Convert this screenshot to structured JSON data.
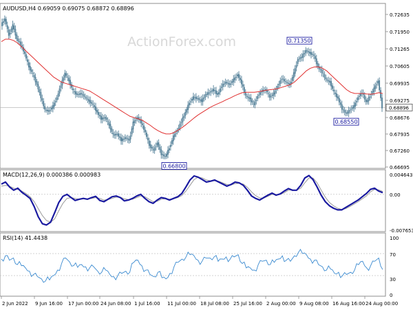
{
  "chart_data": [
    {
      "type": "candlestick",
      "panel": "price",
      "title": "AUDUSD,H4  0.69059 0.69075 0.68872 0.68896",
      "watermark": "ActionForex.com",
      "y_ticks": [
        "0.72635",
        "0.71950",
        "0.71265",
        "0.70605",
        "0.69935",
        "0.69275",
        "0.68676",
        "0.67935",
        "0.67260",
        "0.66695"
      ],
      "ylim": [
        0.6665,
        0.7285
      ],
      "current_price": "0.68896",
      "current_price_value": 0.68896,
      "annotations": [
        {
          "label": "0.71350",
          "value": 0.7135
        },
        {
          "label": "0.66800",
          "value": 0.668
        },
        {
          "label": "0.68550",
          "value": 0.6855
        }
      ],
      "series": [
        {
          "name": "price",
          "color": "#4f7d96",
          "points": [
            0.7215,
            0.724,
            0.7175,
            0.7215,
            0.716,
            0.714,
            0.71,
            0.705,
            0.702,
            0.698,
            0.693,
            0.688,
            0.6875,
            0.6895,
            0.693,
            0.698,
            0.7025,
            0.6995,
            0.6955,
            0.694,
            0.6945,
            0.693,
            0.6915,
            0.69,
            0.687,
            0.6845,
            0.685,
            0.682,
            0.678,
            0.6785,
            0.676,
            0.677,
            0.676,
            0.683,
            0.685,
            0.683,
            0.679,
            0.674,
            0.672,
            0.675,
            0.6705,
            0.6695,
            0.673,
            0.6775,
            0.68,
            0.6835,
            0.687,
            0.691,
            0.693,
            0.6925,
            0.6915,
            0.694,
            0.695,
            0.696,
            0.694,
            0.6975,
            0.699,
            0.698,
            0.7,
            0.702,
            0.6985,
            0.6935,
            0.6925,
            0.69,
            0.6935,
            0.6955,
            0.696,
            0.693,
            0.6945,
            0.6975,
            0.7005,
            0.699,
            0.698,
            0.7025,
            0.708,
            0.709,
            0.7115,
            0.7105,
            0.7095,
            0.705,
            0.703,
            0.7,
            0.699,
            0.695,
            0.6925,
            0.6885,
            0.6865,
            0.688,
            0.6895,
            0.693,
            0.695,
            0.691,
            0.6935,
            0.6965,
            0.6995,
            0.689
          ]
        },
        {
          "name": "moving-average",
          "color": "#e03030",
          "points": [
            0.715,
            0.716,
            0.716,
            0.7155,
            0.7145,
            0.713,
            0.7115,
            0.71,
            0.7085,
            0.707,
            0.7055,
            0.704,
            0.7025,
            0.701,
            0.7,
            0.699,
            0.6985,
            0.698,
            0.6975,
            0.697,
            0.6965,
            0.696,
            0.6955,
            0.6945,
            0.6935,
            0.6925,
            0.6915,
            0.6905,
            0.6895,
            0.6885,
            0.6875,
            0.6865,
            0.6855,
            0.685,
            0.6845,
            0.684,
            0.683,
            0.682,
            0.6808,
            0.6798,
            0.679,
            0.6785,
            0.6785,
            0.679,
            0.68,
            0.681,
            0.6822,
            0.6835,
            0.6848,
            0.686,
            0.687,
            0.688,
            0.689,
            0.6898,
            0.6905,
            0.6912,
            0.692,
            0.6927,
            0.6935,
            0.6942,
            0.6948,
            0.695,
            0.695,
            0.695,
            0.6952,
            0.6955,
            0.6958,
            0.696,
            0.6962,
            0.6965,
            0.697,
            0.6975,
            0.698,
            0.699,
            0.7005,
            0.702,
            0.7035,
            0.7045,
            0.705,
            0.705,
            0.7045,
            0.7035,
            0.702,
            0.7005,
            0.699,
            0.6975,
            0.696,
            0.695,
            0.6945,
            0.6945,
            0.6945,
            0.6943,
            0.6942,
            0.6944,
            0.6948,
            0.6945
          ]
        }
      ]
    },
    {
      "type": "line",
      "panel": "macd",
      "title": "MACD(12,26,9) 0.000386 0.000983",
      "y_ticks": [
        "0.004643",
        "0.00",
        "-0.007653"
      ],
      "ylim": [
        -0.0081,
        0.005
      ],
      "series": [
        {
          "name": "macd",
          "color": "#1a1aa0",
          "points": [
            0.0025,
            0.003,
            0.0018,
            0.001,
            0.0015,
            0.0005,
            -0.0002,
            -0.001,
            -0.003,
            -0.0055,
            -0.0072,
            -0.0075,
            -0.0068,
            -0.0045,
            -0.002,
            -0.0005,
            0.0,
            -0.0008,
            -0.0015,
            -0.0012,
            -0.001,
            -0.0012,
            -0.0008,
            -0.0005,
            -0.0015,
            -0.0018,
            -0.0012,
            -0.0006,
            -0.0004,
            -0.0008,
            -0.0016,
            -0.0014,
            -0.001,
            -0.0004,
            0.0,
            -0.001,
            -0.0018,
            -0.0022,
            -0.0014,
            -0.0008,
            -0.001,
            -0.0014,
            -0.001,
            -0.0006,
            0.0002,
            0.0018,
            0.0035,
            0.0045,
            0.0042,
            0.0036,
            0.003,
            0.0032,
            0.0035,
            0.003,
            0.0025,
            0.002,
            0.0024,
            0.003,
            0.0028,
            0.0022,
            0.001,
            -0.0004,
            -0.001,
            -0.0014,
            -0.0008,
            -0.0002,
            0.0003,
            -0.0002,
            0.0001,
            0.0008,
            0.0014,
            0.001,
            0.001,
            0.0022,
            0.004,
            0.0046,
            0.0036,
            0.0018,
            -0.0002,
            -0.0018,
            -0.0028,
            -0.0034,
            -0.0038,
            -0.0038,
            -0.0032,
            -0.0026,
            -0.002,
            -0.0014,
            -0.0006,
            0.0002,
            0.0012,
            0.0015,
            0.0008,
            0.0004
          ]
        },
        {
          "name": "signal",
          "color": "#9a9a9a",
          "points": [
            0.002,
            0.0022,
            0.002,
            0.0015,
            0.0012,
            0.0008,
            0.0002,
            -0.0006,
            -0.0018,
            -0.0035,
            -0.0052,
            -0.0064,
            -0.0068,
            -0.006,
            -0.004,
            -0.0022,
            -0.001,
            -0.0008,
            -0.001,
            -0.0012,
            -0.0011,
            -0.0011,
            -0.001,
            -0.0008,
            -0.001,
            -0.0014,
            -0.0013,
            -0.001,
            -0.0007,
            -0.0007,
            -0.0011,
            -0.0013,
            -0.0012,
            -0.0008,
            -0.0004,
            -0.0006,
            -0.0012,
            -0.0018,
            -0.0017,
            -0.0012,
            -0.0011,
            -0.0012,
            -0.0011,
            -0.0008,
            -0.0003,
            0.0008,
            0.0022,
            0.0036,
            0.0042,
            0.004,
            0.0035,
            0.0033,
            0.0033,
            0.0032,
            0.0028,
            0.0024,
            0.0023,
            0.0026,
            0.0027,
            0.0025,
            0.0017,
            0.0006,
            -0.0003,
            -0.0009,
            -0.0009,
            -0.0005,
            0.0,
            -0.0001,
            0.0,
            0.0004,
            0.001,
            0.0011,
            0.001,
            0.0015,
            0.0028,
            0.004,
            0.004,
            0.0028,
            0.001,
            -0.0007,
            -0.002,
            -0.0028,
            -0.0034,
            -0.0037,
            -0.0035,
            -0.003,
            -0.0024,
            -0.0018,
            -0.0011,
            -0.0004,
            0.0006,
            0.0012,
            0.0011,
            0.0007
          ]
        }
      ]
    },
    {
      "type": "line",
      "panel": "rsi",
      "title": "RSI(14) 41.4438",
      "y_ticks": [
        "100",
        "70",
        "30",
        "0"
      ],
      "ylim": [
        0,
        100
      ],
      "levels": [
        70,
        30
      ],
      "series": [
        {
          "name": "rsi",
          "color": "#3a8ad0",
          "points": [
            60,
            66,
            58,
            62,
            50,
            48,
            44,
            38,
            32,
            28,
            24,
            20,
            22,
            30,
            40,
            52,
            62,
            55,
            48,
            45,
            50,
            46,
            44,
            46,
            38,
            36,
            40,
            32,
            28,
            30,
            34,
            38,
            36,
            54,
            58,
            48,
            40,
            32,
            28,
            36,
            26,
            24,
            34,
            46,
            54,
            60,
            64,
            68,
            66,
            58,
            56,
            62,
            62,
            64,
            56,
            60,
            64,
            60,
            64,
            68,
            52,
            44,
            44,
            40,
            50,
            56,
            58,
            50,
            54,
            60,
            66,
            58,
            56,
            66,
            72,
            70,
            68,
            60,
            58,
            50,
            46,
            40,
            42,
            34,
            36,
            30,
            32,
            36,
            40,
            50,
            56,
            44,
            48,
            56,
            62,
            41
          ]
        }
      ]
    }
  ],
  "x_axis": {
    "tick_labels": [
      "2 Jun 2022",
      "9 Jun 16:00",
      "17 Jun 00:00",
      "24 Jun 08:00",
      "1 Jul 16:00",
      "11 Jul 00:00",
      "18 Jul 08:00",
      "25 Jul 16:00",
      "2 Aug 00:00",
      "9 Aug 08:00",
      "16 Aug 16:00",
      "24 Aug 00:00"
    ]
  },
  "colors": {
    "price_line": "#4f7d96",
    "ma_line": "#e03030",
    "macd_line": "#1a1aa0",
    "signal_line": "#9a9a9a",
    "rsi_line": "#3a8ad0",
    "panel_border": "#8c8c8c",
    "label_box": "#1a1aa0",
    "watermark": "#d8d8d8"
  }
}
